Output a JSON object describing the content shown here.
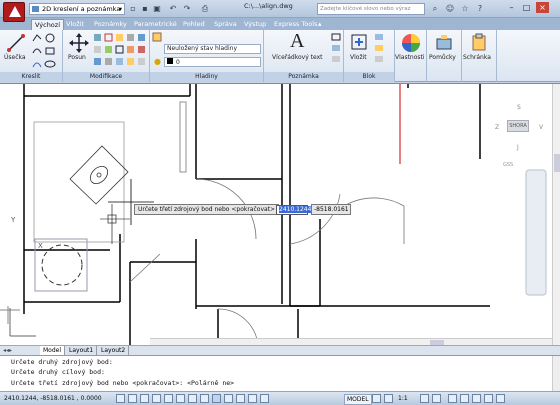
{
  "titlebar": {
    "workspace": "2D kreslení a poznámka",
    "document": "C:\\...\\align.dwg",
    "search_placeholder": "Zadejte klíčové slovo nebo výraz"
  },
  "tabs": [
    "Výchozí",
    "Vložit",
    "Poznámky",
    "Parametrické",
    "Pohled",
    "Správa",
    "Výstup",
    "Express Tools"
  ],
  "ribbon": {
    "panels": {
      "kreslit": "Kreslit",
      "modifikace": "Modifikace",
      "hladiny": "Hladiny",
      "poznamka": "Poznámka",
      "blok": "Blok"
    },
    "buttons": {
      "usecka": "Úsečka",
      "posun": "Posun",
      "text": "Víceřádkový text",
      "vlozit": "Vložit",
      "vlastnosti": "Vlastnosti",
      "pomucky": "Pomůcky",
      "schranka": "Schránka"
    },
    "layer_state": "Neuložený stav hladiny",
    "layer_current": "0"
  },
  "canvas": {
    "tooltip": "Určete třetí zdrojový bod nebo <pokračovat>",
    "coord_x": "2410.1244",
    "coord_y": "-8518.0161",
    "viewcube": {
      "north": "S",
      "south": "J",
      "west": "Z",
      "east": "V",
      "center": "SHORA",
      "wcs": "GSS"
    },
    "ucs_y": "Y",
    "ucs_x": "X"
  },
  "layout_tabs": [
    "Model",
    "Layout1",
    "Layout2"
  ],
  "command_lines": [
    "Určete druhý zdrojový bod:",
    "Určete druhý cílový bod:",
    "Určete třetí zdrojový bod nebo <pokračovat>:  <Polárně ne>"
  ],
  "statusbar": {
    "coords": "2410.1244, -8518.0161 , 0.0000",
    "model": "MODEL",
    "scale": "1:1"
  }
}
